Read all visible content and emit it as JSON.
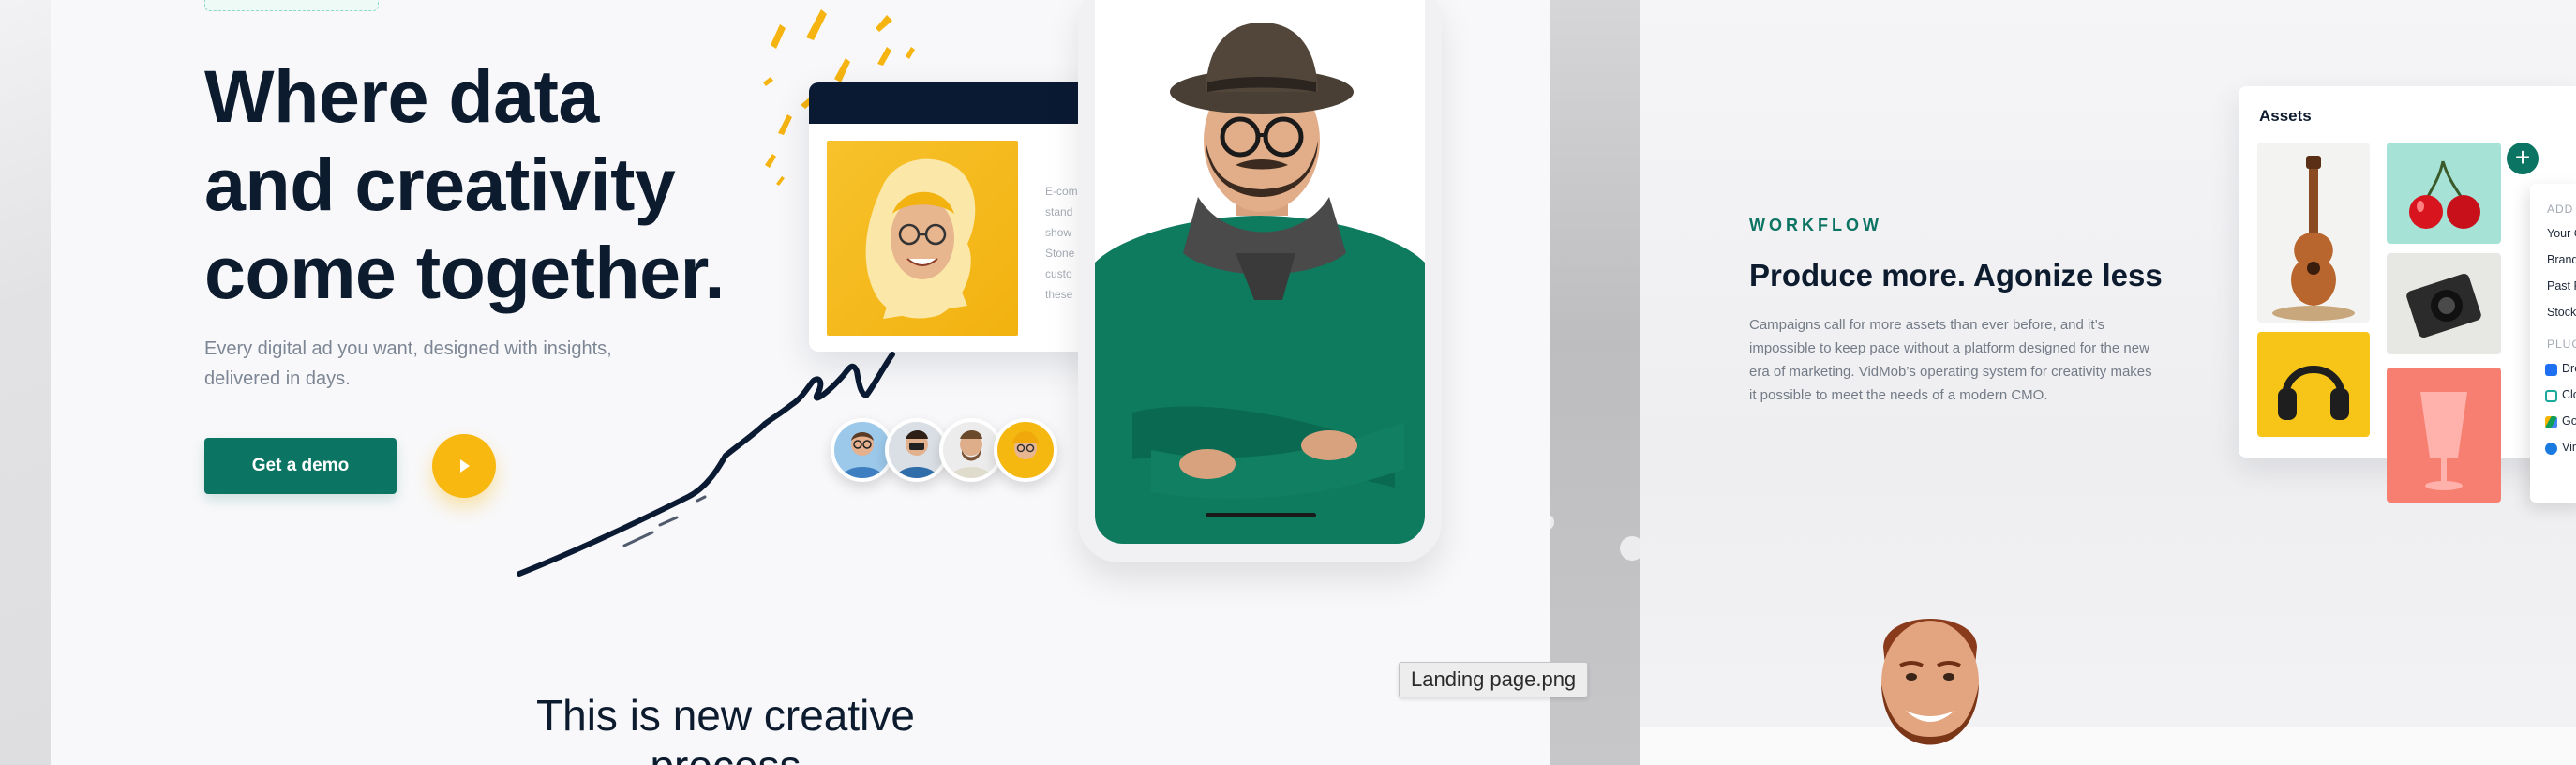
{
  "landing": {
    "hero_title_lines": [
      "Where data",
      "and creativity",
      "come together."
    ],
    "hero_subtitle_lines": [
      "Every digital ad you want, designed with insights,",
      "delivered in days."
    ],
    "demo_button": "Get a demo",
    "product_card_lines": [
      "E-com",
      "stand",
      "show",
      "Stone",
      "custo",
      "these"
    ],
    "section_title_lines": [
      "This is new creative",
      "process"
    ],
    "file_label": "Landing page.png"
  },
  "workflow": {
    "eyebrow": "WORKFLOW",
    "title": "Produce more. Agonize less",
    "body_lines": [
      "Campaigns call for more assets than ever before, and it’s",
      "impossible to keep pace without a platform designed for the new",
      "era of marketing. VidMob’s operating system for creativity makes",
      "it possible to meet the needs of a modern CMO."
    ],
    "assets_title": "Assets",
    "add_button": "+",
    "add_from": {
      "header": "ADD FRO",
      "items": [
        "Your Co",
        "Brand As",
        "Past Proj",
        "Stock Lib"
      ],
      "plugins_header": "PLUGINS",
      "plugins": [
        "Drop",
        "Clou",
        "Goo",
        "Vime"
      ]
    }
  },
  "colors": {
    "accent_green": "#0c7463",
    "accent_yellow": "#f8b80f",
    "navy": "#0d1b2e",
    "muted_text": "#7d8694"
  },
  "icons": [
    "play-icon",
    "plus-icon",
    "dropbox-icon",
    "cloud-icon",
    "google-drive-icon",
    "vimeo-icon"
  ]
}
